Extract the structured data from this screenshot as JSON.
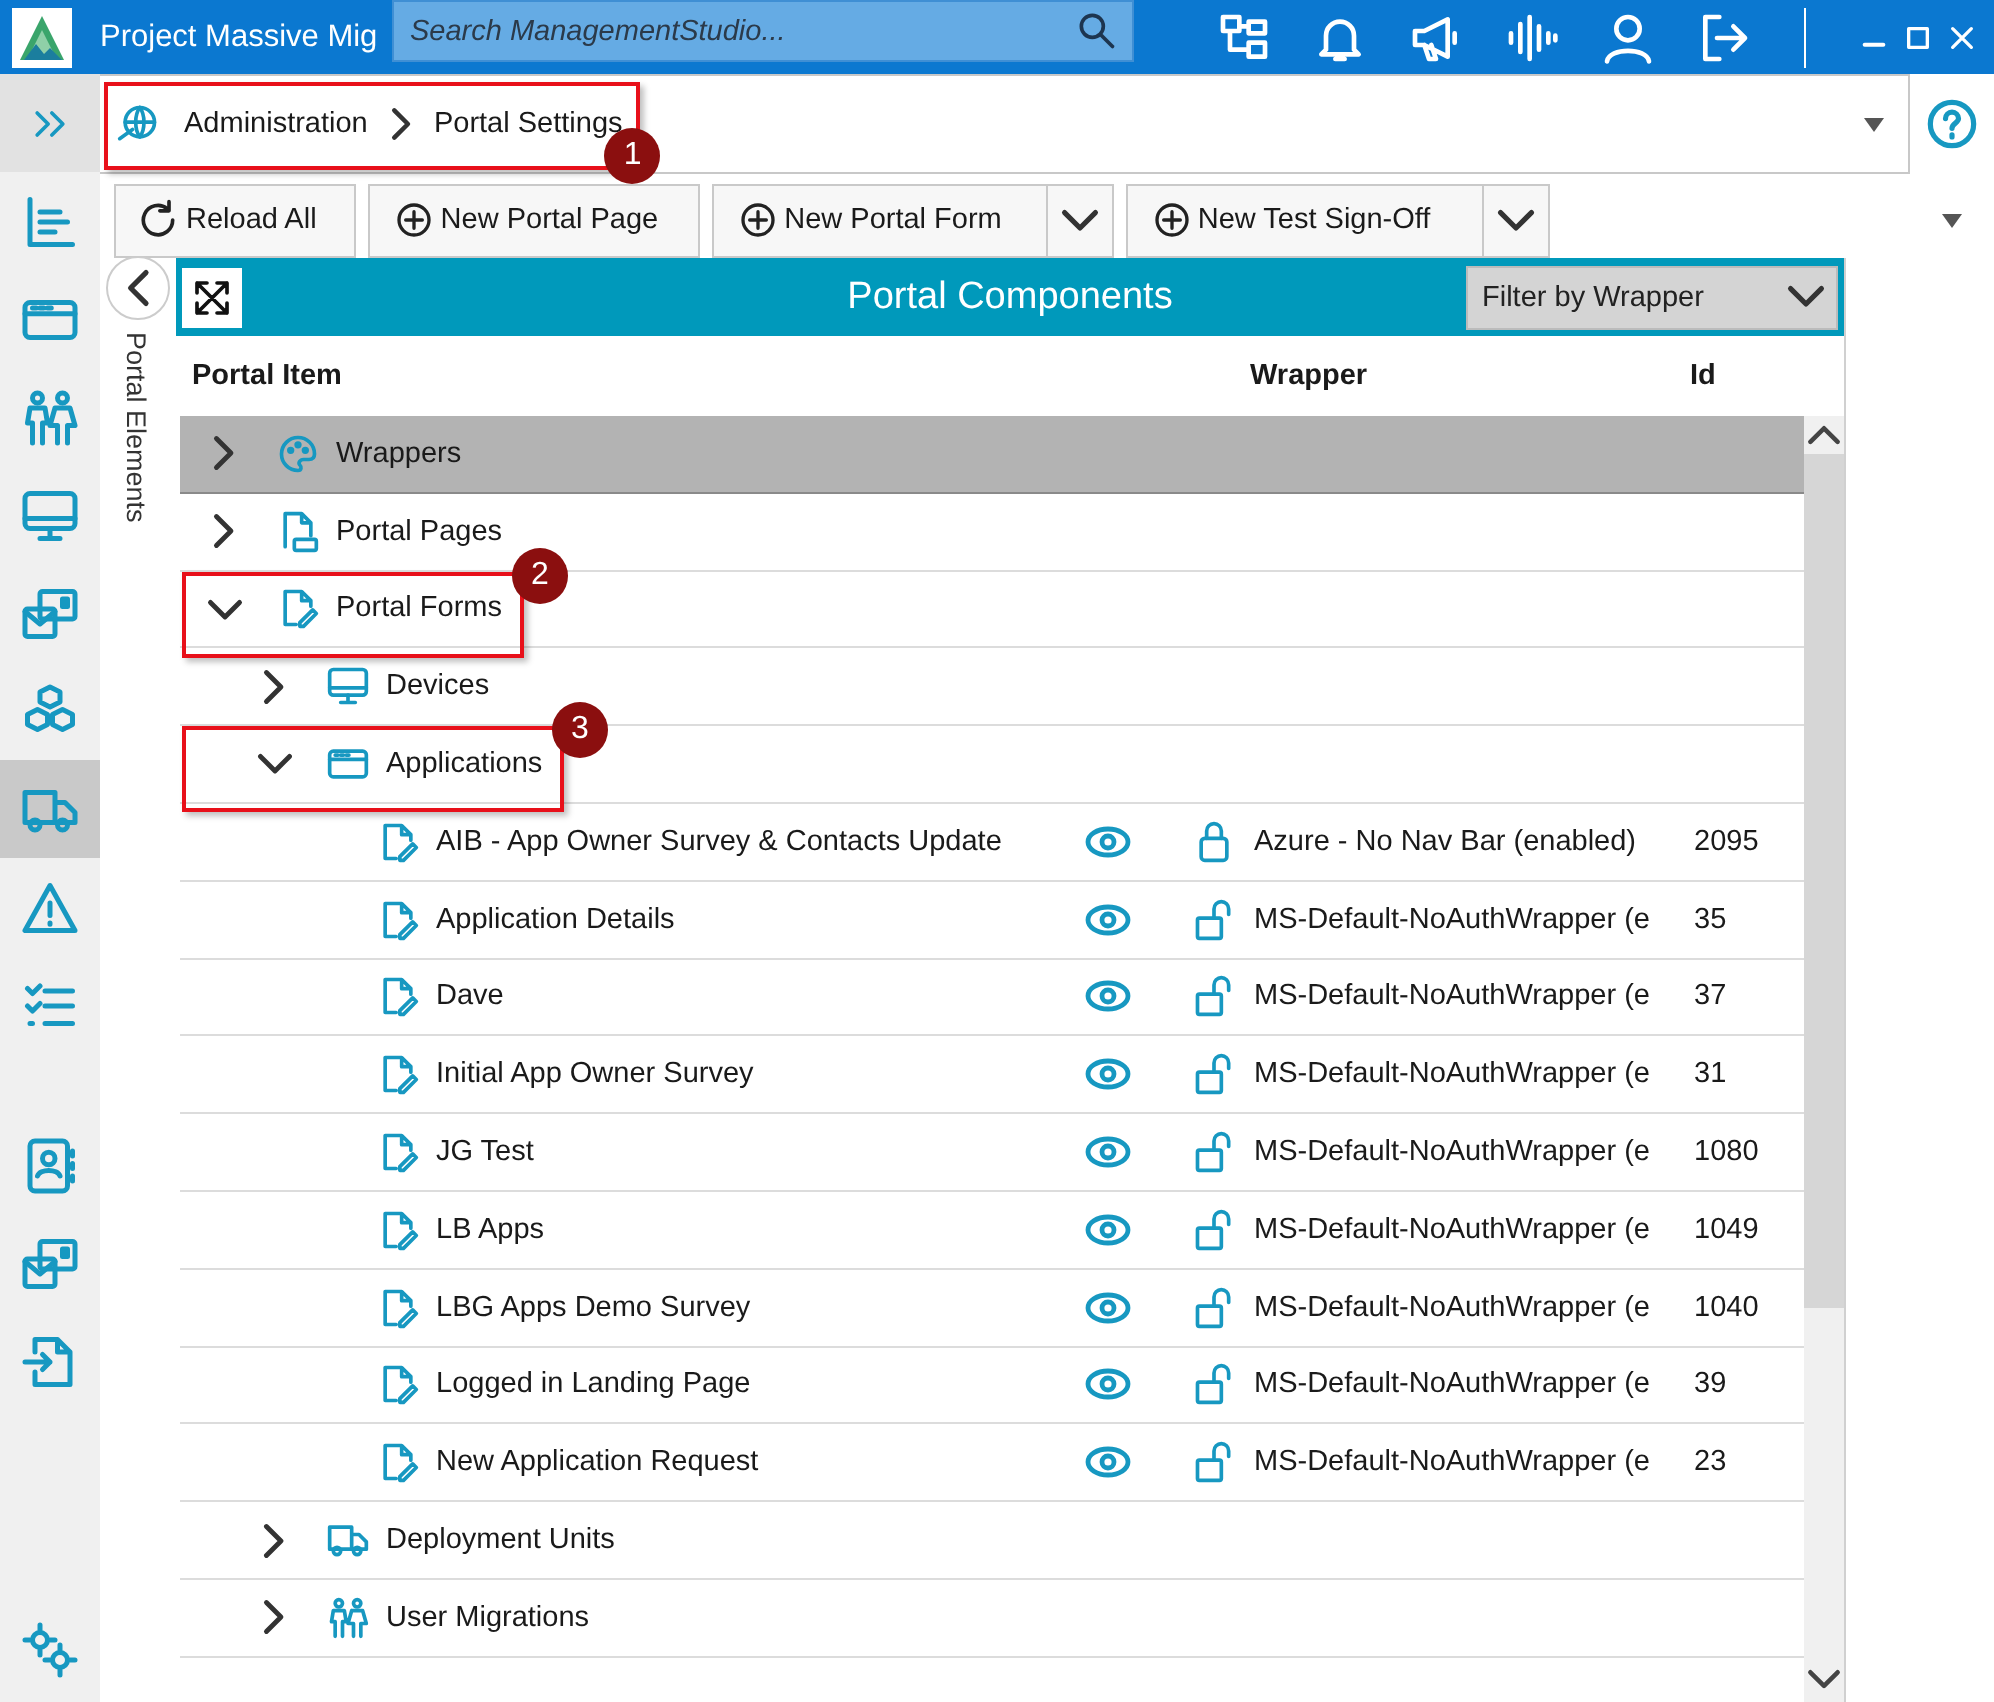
{
  "app": {
    "title": "Project Massive Mig",
    "search": {
      "placeholder": "Search ManagementStudio..."
    }
  },
  "nav_rail": {
    "groups": [
      {
        "items": [
          {
            "kind": "chevrons",
            "selected": false
          },
          {
            "kind": "chart",
            "selected": false
          },
          {
            "kind": "window",
            "selected": false
          },
          {
            "kind": "people",
            "selected": false
          },
          {
            "kind": "monitor",
            "selected": false
          },
          {
            "kind": "mail",
            "selected": false
          },
          {
            "kind": "cubes",
            "selected": false
          },
          {
            "kind": "truck",
            "selected": true
          },
          {
            "kind": "warning",
            "selected": false
          },
          {
            "kind": "checklist",
            "selected": false
          }
        ]
      },
      {
        "items": [
          {
            "kind": "contact",
            "selected": false
          },
          {
            "kind": "mail",
            "selected": false
          },
          {
            "kind": "import",
            "selected": false
          }
        ]
      },
      {
        "items": [
          {
            "kind": "gears",
            "selected": false
          }
        ]
      }
    ]
  },
  "breadcrumb": {
    "items": [
      "Administration",
      "Portal Settings"
    ],
    "callout": "1"
  },
  "toolbar": {
    "buttons": [
      {
        "label": "Reload All",
        "kind": "reload"
      },
      {
        "label": "New Portal Page",
        "kind": "add"
      },
      {
        "label": "New Portal Form",
        "kind": "add-split"
      },
      {
        "label": "New Test Sign-Off",
        "kind": "add-split"
      }
    ]
  },
  "side_tab": {
    "label": "Portal Elements"
  },
  "panel": {
    "title": "Portal Components",
    "filter": {
      "label": "Filter by Wrapper"
    },
    "columns": [
      "Portal Item",
      "Wrapper",
      "Id"
    ],
    "tree": [
      {
        "label": "Wrappers",
        "kind": "wrapper-group",
        "expanded": false,
        "selected": true
      },
      {
        "label": "Portal Pages",
        "kind": "page-group",
        "expanded": false,
        "selected": false
      },
      {
        "label": "Portal Forms",
        "kind": "form-group",
        "expanded": true,
        "selected": false,
        "callout": "2",
        "children": [
          {
            "label": "Devices",
            "kind": "device-group",
            "expanded": false,
            "selected": false
          },
          {
            "label": "Applications",
            "kind": "application-group",
            "expanded": true,
            "selected": false,
            "callout": "3",
            "children": [
              {
                "label": "AIB - App Owner Survey & Contacts Update",
                "kind": "form",
                "selected": false,
                "locked": true,
                "wrapper": "Azure - No Nav Bar (enabled)",
                "id": "2095"
              },
              {
                "label": "Application Details",
                "kind": "form",
                "selected": false,
                "locked": false,
                "wrapper": "MS-Default-NoAuthWrapper (e",
                "id": "35"
              },
              {
                "label": "Dave",
                "kind": "form",
                "selected": false,
                "locked": false,
                "wrapper": "MS-Default-NoAuthWrapper (e",
                "id": "37"
              },
              {
                "label": "Initial App Owner Survey",
                "kind": "form",
                "selected": false,
                "locked": false,
                "wrapper": "MS-Default-NoAuthWrapper (e",
                "id": "31"
              },
              {
                "label": "JG Test",
                "kind": "form",
                "selected": false,
                "locked": false,
                "wrapper": "MS-Default-NoAuthWrapper (e",
                "id": "1080"
              },
              {
                "label": "LB Apps",
                "kind": "form",
                "selected": false,
                "locked": false,
                "wrapper": "MS-Default-NoAuthWrapper (e",
                "id": "1049"
              },
              {
                "label": "LBG Apps Demo Survey",
                "kind": "form",
                "selected": false,
                "locked": false,
                "wrapper": "MS-Default-NoAuthWrapper (e",
                "id": "1040"
              },
              {
                "label": "Logged in Landing Page",
                "kind": "form",
                "selected": false,
                "locked": false,
                "wrapper": "MS-Default-NoAuthWrapper (e",
                "id": "39"
              },
              {
                "label": "New Application Request",
                "kind": "form",
                "selected": false,
                "locked": false,
                "wrapper": "MS-Default-NoAuthWrapper (e",
                "id": "23"
              }
            ]
          },
          {
            "label": "Deployment Units",
            "kind": "deployment-group",
            "expanded": false,
            "selected": false
          },
          {
            "label": "User Migrations",
            "kind": "migration-group",
            "expanded": false,
            "selected": false
          }
        ]
      }
    ]
  }
}
